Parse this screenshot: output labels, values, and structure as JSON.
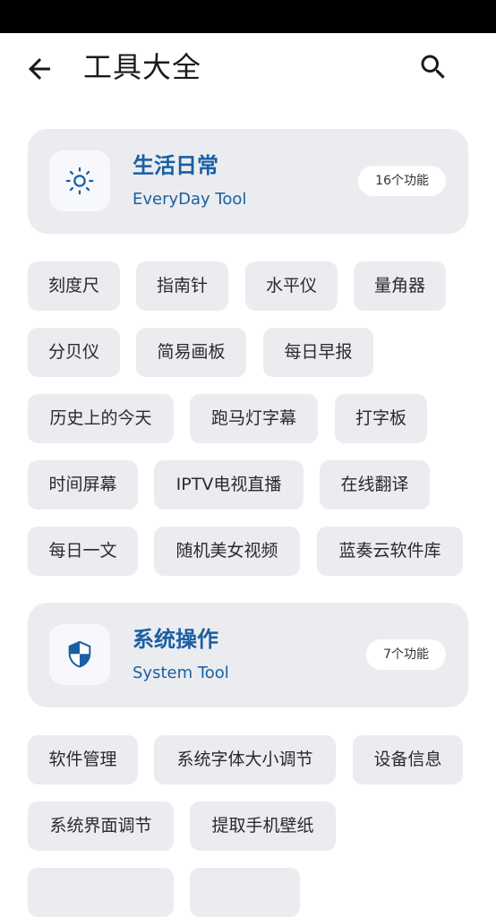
{
  "appbar": {
    "title": "工具大全"
  },
  "sections": [
    {
      "title": "生活日常",
      "subtitle": "EveryDay Tool",
      "badge": "16个功能",
      "icon": "sun-icon",
      "items": [
        "刻度尺",
        "指南针",
        "水平仪",
        "量角器",
        "分贝仪",
        "简易画板",
        "每日早报",
        "历史上的今天",
        "跑马灯字幕",
        "打字板",
        "时间屏幕",
        "IPTV电视直播",
        "在线翻译",
        "每日一文",
        "随机美女视频",
        "蓝奏云软件库"
      ]
    },
    {
      "title": "系统操作",
      "subtitle": "System Tool",
      "badge": "7个功能",
      "icon": "shield-icon",
      "items": [
        "软件管理",
        "系统字体大小调节",
        "设备信息",
        "系统界面调节",
        "提取手机壁纸"
      ]
    }
  ],
  "colors": {
    "accent": "#1a5fa3",
    "card_bg": "#ebecf0",
    "status_bar": "#000000"
  }
}
